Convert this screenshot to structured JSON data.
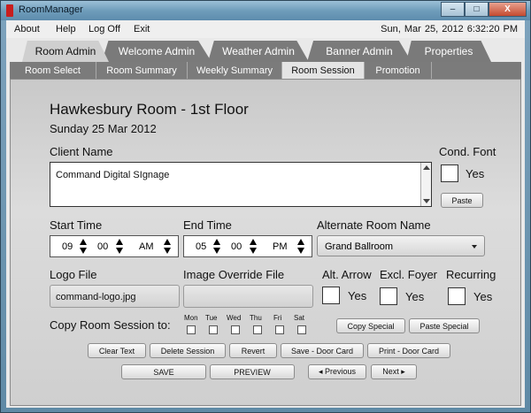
{
  "window": {
    "title": "RoomManager",
    "minimize_label": "–",
    "maximize_label": "□",
    "close_label": "X"
  },
  "menu": {
    "about": "About",
    "help": "Help",
    "logoff": "Log Off",
    "exit": "Exit",
    "datetime": "Sun, Mar 25, 2012    6:32:20 PM"
  },
  "tabs_main": [
    "Room Admin",
    "Welcome Admin",
    "Weather Admin",
    "Banner Admin",
    "Properties"
  ],
  "tabs_sub": [
    "Room Select",
    "Room Summary",
    "Weekly Summary",
    "Room Session",
    "Promotion"
  ],
  "room": {
    "name": "Hawkesbury Room - 1st Floor",
    "date": "Sunday 25 Mar 2012"
  },
  "client": {
    "label": "Client Name",
    "value": "Command Digital SIgnage"
  },
  "cond_font": {
    "label": "Cond. Font",
    "yes": "Yes",
    "paste": "Paste"
  },
  "start_time": {
    "label": "Start Time",
    "hour": "09",
    "minute": "00",
    "ampm": "AM"
  },
  "end_time": {
    "label": "End Time",
    "hour": "05",
    "minute": "00",
    "ampm": "PM"
  },
  "alt_room": {
    "label": "Alternate Room Name",
    "value": "Grand Ballroom"
  },
  "logo": {
    "label": "Logo File",
    "value": "command-logo.jpg"
  },
  "image_override": {
    "label": "Image Override File",
    "value": ""
  },
  "alt_arrow": {
    "label": "Alt. Arrow",
    "yes": "Yes"
  },
  "excl_foyer": {
    "label": "Excl. Foyer",
    "yes": "Yes"
  },
  "recurring": {
    "label": "Recurring",
    "yes": "Yes"
  },
  "copy": {
    "label": "Copy Room Session to:",
    "days": [
      "Mon",
      "Tue",
      "Wed",
      "Thu",
      "Fri",
      "Sat"
    ],
    "copy_special": "Copy Special",
    "paste_special": "Paste Special"
  },
  "buttons": {
    "clear_text": "Clear Text",
    "delete_session": "Delete Session",
    "revert": "Revert",
    "save_door_card": "Save - Door Card",
    "print_door_card": "Print - Door Card",
    "save": "SAVE",
    "preview": "PREVIEW",
    "previous": "◂ Previous",
    "next": "Next ▸"
  }
}
